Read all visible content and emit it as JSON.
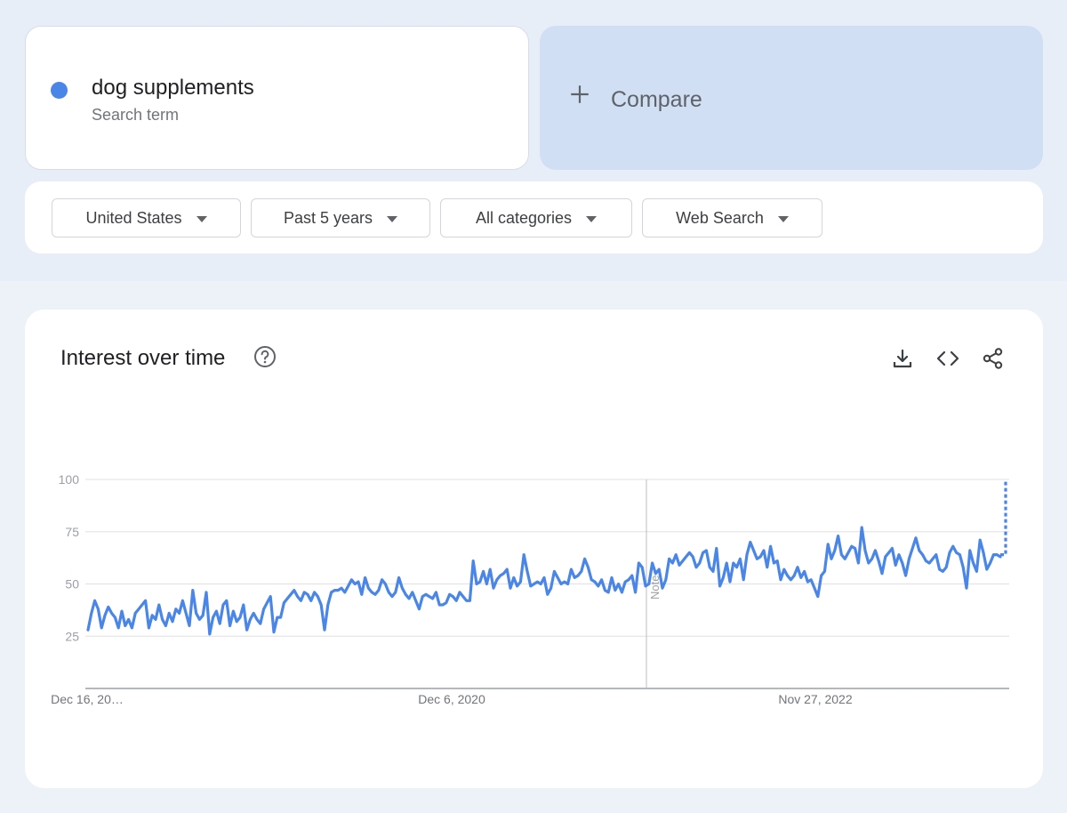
{
  "search_term": {
    "name": "dog supplements",
    "subtitle": "Search term",
    "color": "#4a86e8"
  },
  "compare": {
    "icon": "plus-icon",
    "label": "Compare"
  },
  "filters": [
    {
      "label": "United States",
      "icon": "caret-down-icon"
    },
    {
      "label": "Past 5 years",
      "icon": "caret-down-icon"
    },
    {
      "label": "All categories",
      "icon": "caret-down-icon"
    },
    {
      "label": "Web Search",
      "icon": "caret-down-icon"
    }
  ],
  "panel": {
    "title": "Interest over time",
    "icons": [
      "help-icon",
      "download-icon",
      "embed-code-icon",
      "share-icon"
    ]
  },
  "chart_data": {
    "type": "line",
    "title": "Interest over time",
    "x_ticks": [
      "Dec 16, 20…",
      "Dec 6, 2020",
      "Nov 27, 2022"
    ],
    "y_ticks": [
      100,
      75,
      50,
      25
    ],
    "ylim": [
      0,
      100
    ],
    "grid": true,
    "annotation": "Note",
    "partial_data_dashed": true,
    "series": [
      {
        "color": "#4a86e8",
        "values": [
          28,
          36,
          42,
          38,
          29,
          35,
          39,
          36,
          34,
          29,
          37,
          30,
          33,
          29,
          36,
          38,
          40,
          42,
          29,
          35,
          33,
          40,
          33,
          30,
          36,
          32,
          38,
          36,
          42,
          36,
          30,
          47,
          36,
          33,
          35,
          46,
          26,
          34,
          37,
          31,
          40,
          42,
          30,
          37,
          32,
          34,
          40,
          28,
          33,
          36,
          33,
          31,
          38,
          41,
          44,
          27,
          34,
          34,
          41,
          43,
          45,
          47,
          44,
          42,
          46,
          45,
          42,
          46,
          44,
          40,
          28,
          40,
          46,
          47,
          47,
          48,
          46,
          49,
          52,
          50,
          51,
          45,
          53,
          48,
          46,
          45,
          47,
          52,
          50,
          46,
          44,
          46,
          53,
          48,
          45,
          43,
          46,
          42,
          38,
          44,
          45,
          44,
          43,
          46,
          40,
          40,
          41,
          45,
          44,
          42,
          46,
          44,
          42,
          42,
          61,
          50,
          51,
          56,
          50,
          57,
          48,
          52,
          54,
          55,
          57,
          48,
          53,
          49,
          51,
          64,
          56,
          49,
          50,
          51,
          50,
          53,
          45,
          48,
          56,
          53,
          50,
          51,
          50,
          57,
          53,
          54,
          56,
          62,
          58,
          52,
          51,
          49,
          52,
          47,
          46,
          53,
          47,
          50,
          46,
          51,
          52,
          54,
          46,
          60,
          58,
          49,
          50,
          60,
          55,
          57,
          48,
          52,
          62,
          60,
          64,
          59,
          61,
          63,
          65,
          63,
          58,
          60,
          65,
          66,
          58,
          56,
          67,
          49,
          53,
          60,
          51,
          60,
          58,
          62,
          52,
          64,
          70,
          66,
          62,
          63,
          66,
          58,
          68,
          60,
          61,
          52,
          57,
          54,
          52,
          54,
          58,
          53,
          56,
          51,
          52,
          48,
          44,
          54,
          56,
          69,
          62,
          66,
          73,
          64,
          62,
          65,
          68,
          67,
          60,
          77,
          66,
          60,
          62,
          66,
          61,
          55,
          63,
          65,
          67,
          59,
          64,
          60,
          54,
          62,
          67,
          72,
          66,
          64,
          61,
          60,
          62,
          64,
          57,
          56,
          58,
          65,
          68,
          65,
          64,
          58,
          48,
          66,
          60,
          56,
          71,
          65,
          57,
          60,
          64,
          64,
          63
        ]
      }
    ],
    "partial": [
      64,
      100
    ]
  }
}
